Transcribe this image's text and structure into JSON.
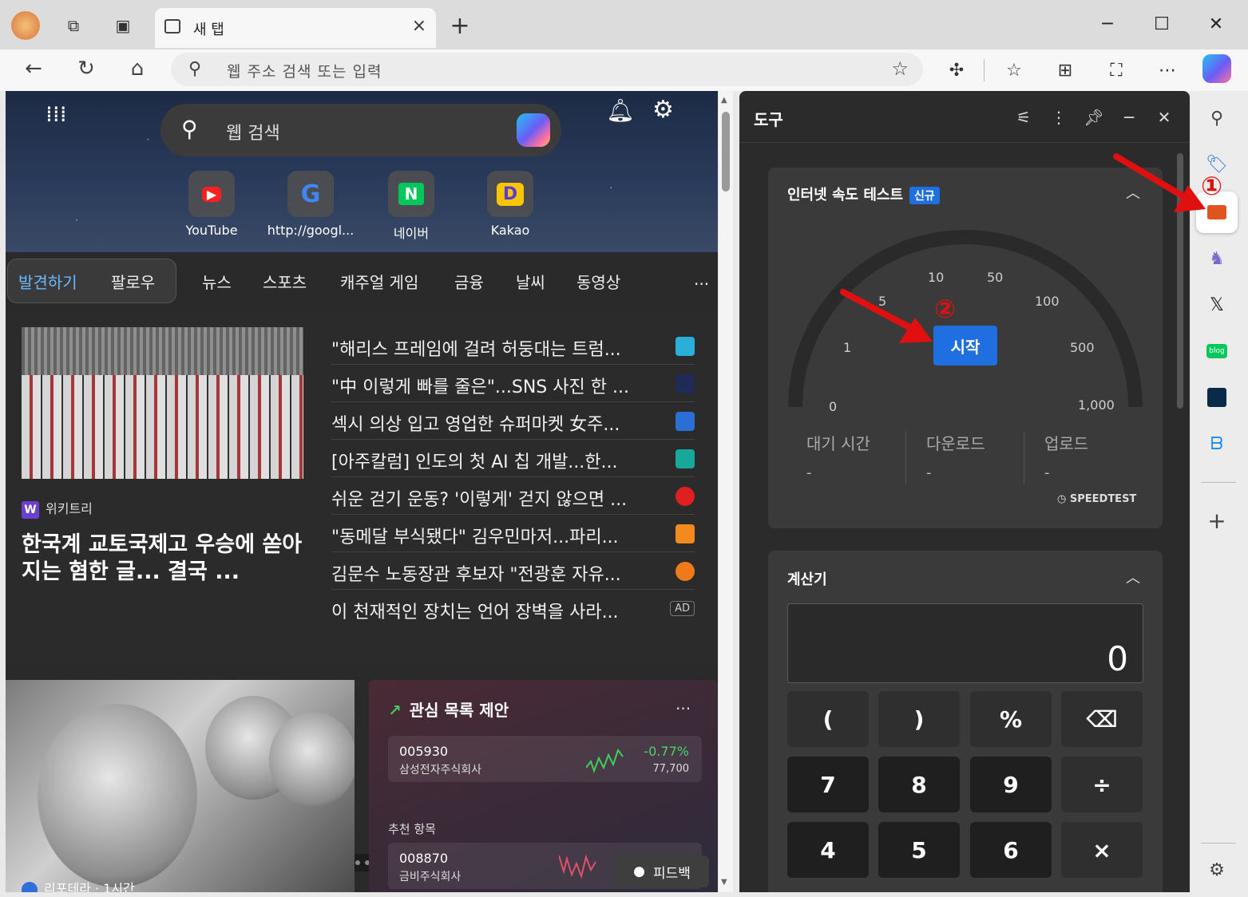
{
  "tab": {
    "title": "새 탭",
    "close": "×",
    "new_tab": "+"
  },
  "window": {
    "minimize": "─",
    "maximize": "☐",
    "close": "✕"
  },
  "nav": {
    "back": "←",
    "refresh": "↻",
    "home": "⌂"
  },
  "omnibox": {
    "placeholder": "웹 주소 검색 또는 입력"
  },
  "toolbar_icons": [
    "extensions-icon",
    "favorites-icon",
    "collections-icon",
    "screenshot-icon",
    "more-icon",
    "copilot-icon"
  ],
  "ntp": {
    "search_placeholder": "웹 검색",
    "quicklinks": [
      {
        "label": "YouTube",
        "glyph": "▶",
        "color": "#ff1f1f"
      },
      {
        "label": "http://googl...",
        "glyph": "G",
        "color": "#4285f4"
      },
      {
        "label": "네이버",
        "glyph": "N",
        "color": "#03c75a"
      },
      {
        "label": "Kakao",
        "glyph": "D",
        "color": "#f7c600"
      }
    ],
    "categories": {
      "discover": "발견하기",
      "follow": "팔로우",
      "items": [
        "뉴스",
        "스포츠",
        "캐주얼 게임",
        "금융",
        "날씨",
        "동영상"
      ],
      "more": "..."
    },
    "lead": {
      "source": "위키트리",
      "source_glyph": "W",
      "title": "한국계 교토국제고 우승에 쏟아지는 혐한 글... 결국 ..."
    },
    "headlines": [
      {
        "text": "\"해리스 프레임에 걸려 허둥대는 트럼...",
        "logo_color": "#2ab0d8"
      },
      {
        "text": "\"中 이렇게 빠를 줄은\"...SNS 사진 한 ...",
        "logo_color": "#1f2a55"
      },
      {
        "text": "섹시 의상 입고 영업한 슈퍼마켓 女주...",
        "logo_color": "#2a6fd6"
      },
      {
        "text": "[아주칼럼] 인도의 첫 AI 칩 개발...한...",
        "logo_color": "#18a89a"
      },
      {
        "text": "쉬운 걷기 운동? '이렇게' 걷지 않으면 ...",
        "logo_color": "#e02020"
      },
      {
        "text": "\"동메달 부식됐다\" 김우민마저...파리...",
        "logo_color": "#f28a1e"
      },
      {
        "text": "김문수 노동장관 후보자 \"전광훈 자유...",
        "logo_color": "#f07a1a"
      },
      {
        "text": "이 천재적인 장치는 언어 장벽을 사라...",
        "ad": "AD"
      }
    ],
    "photo_caption": "리포테라 · 1시간",
    "watchlist": {
      "title": "관심 목록 제안",
      "more": "...",
      "stocks": [
        {
          "code": "005930",
          "name": "삼성전자주식회사",
          "pct": "-0.77%",
          "price": "77,700"
        },
        {
          "code": "008870",
          "name": "금비주식회사",
          "pct": "",
          "price": ""
        }
      ],
      "rec_label": "추천 항목"
    },
    "feedback": "피드백"
  },
  "tools": {
    "title": "도구",
    "speedtest": {
      "title": "인터넷 속도 테스트",
      "badge": "신규",
      "start": "시작",
      "gauge_labels": [
        "0",
        "1",
        "5",
        "10",
        "50",
        "100",
        "500",
        "1,000"
      ],
      "metrics": [
        {
          "label": "대기 시간",
          "value": "-"
        },
        {
          "label": "다운로드",
          "value": "-"
        },
        {
          "label": "업로드",
          "value": "-"
        }
      ],
      "brand": "SPEEDTEST"
    },
    "calculator": {
      "title": "계산기",
      "display": "0",
      "keys": [
        "(",
        ")",
        "%",
        "⌫",
        "7",
        "8",
        "9",
        "÷",
        "4",
        "5",
        "6",
        "×"
      ]
    }
  },
  "annotations": {
    "one": "①",
    "two": "②"
  },
  "colors": {
    "accent": "#1f6fe0",
    "arrow": "#e01010",
    "positive": "#4bd26a"
  }
}
